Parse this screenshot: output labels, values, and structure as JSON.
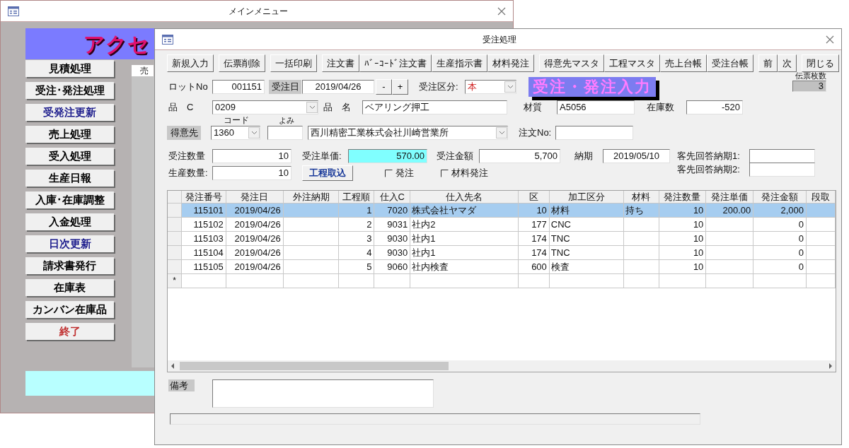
{
  "main_window": {
    "title": "メインメニュー",
    "banner": "アクセ",
    "tab": "売",
    "menu": [
      {
        "label": "見積処理",
        "color": "#000000"
      },
      {
        "label": "受注･発注処理",
        "color": "#000000"
      },
      {
        "label": "受発注更新",
        "color": "#1c1c8c"
      },
      {
        "label": "売上処理",
        "color": "#000000"
      },
      {
        "label": "受入処理",
        "color": "#000000"
      },
      {
        "label": "生産日報",
        "color": "#000000"
      },
      {
        "label": "入庫･在庫調整",
        "color": "#000000"
      },
      {
        "label": "入金処理",
        "color": "#000000"
      },
      {
        "label": "日次更新",
        "color": "#1c1c8c"
      },
      {
        "label": "請求書発行",
        "color": "#000000"
      },
      {
        "label": "在庫表",
        "color": "#000000"
      },
      {
        "label": "カンバン在庫品",
        "color": "#000000"
      },
      {
        "label": "終了",
        "color": "#c03030"
      }
    ]
  },
  "order_window": {
    "title": "受注処理",
    "toolbar": [
      [
        "新規入力"
      ],
      [
        "伝票削除"
      ],
      [
        "一括印刷"
      ],
      [
        "注文書",
        "ﾊﾞｰｺｰﾄﾞ注文書",
        "生産指示書",
        "材料発注"
      ],
      [
        "得意先マスタ",
        "工程マスタ",
        "売上台帳",
        "受注台帳"
      ],
      [
        "前",
        "次"
      ],
      [
        "閉じる"
      ]
    ],
    "form": {
      "lot_no": {
        "label": "ロットNo",
        "value": "001151"
      },
      "order_date": {
        "label": "受注日",
        "value": "2019/04/26"
      },
      "date_buttons": [
        "-",
        "+"
      ],
      "order_type": {
        "label": "受注区分:",
        "value": "本"
      },
      "form_title": "受注・発注入力",
      "slip_count": {
        "label": "伝票枚数",
        "value": "3"
      },
      "item_code": {
        "label": "品　C",
        "value": "0209"
      },
      "item_name": {
        "label": "品　名",
        "value": "ベアリング押工"
      },
      "material": {
        "label": "材質",
        "value": "A5056"
      },
      "stock": {
        "label": "在庫数",
        "value": "-520"
      },
      "customer": {
        "label": "得意先",
        "code_caption": "コード",
        "code": "1360",
        "reading_caption": "よみ",
        "name": "西川精密工業株式会社川崎営業所"
      },
      "po_no": {
        "label": "注文No:"
      },
      "order_qty": {
        "label": "受注数量",
        "value": "10"
      },
      "unit_price": {
        "label": "受注単価:",
        "value": "570.00"
      },
      "amount": {
        "label": "受注金額",
        "value": "5,700"
      },
      "due_date": {
        "label": "納期",
        "value": "2019/05/10"
      },
      "reply_due_1": {
        "label": "客先回答納期1:"
      },
      "production_qty": {
        "label": "生産数量:",
        "value": "10"
      },
      "import_button": "工程取込",
      "checkboxes": [
        {
          "label": "発注",
          "checked": false
        },
        {
          "label": "材料発注",
          "checked": false
        }
      ],
      "reply_due_2": {
        "label": "客先回答納期2:"
      }
    },
    "grid": {
      "columns": [
        {
          "label": "発注番号",
          "kind": "number"
        },
        {
          "label": "発注日",
          "kind": "number"
        },
        {
          "label": "外注納期",
          "kind": "number"
        },
        {
          "label": "工程順",
          "kind": "number"
        },
        {
          "label": "仕入C",
          "kind": "number"
        },
        {
          "label": "仕入先名",
          "kind": "text"
        },
        {
          "label": "区",
          "kind": "number"
        },
        {
          "label": "加工区分",
          "kind": "text"
        },
        {
          "label": "材料",
          "kind": "text"
        },
        {
          "label": "発注数量",
          "kind": "number"
        },
        {
          "label": "発注単価",
          "kind": "number"
        },
        {
          "label": "発注金額",
          "kind": "number"
        },
        {
          "label": "段取",
          "kind": "number"
        }
      ],
      "rows": [
        {
          "selected": true,
          "cells": [
            "115101",
            "2019/04/26",
            null,
            "1",
            "7020",
            "株式会社ヤマダ",
            "10",
            "材料",
            "持ち",
            "10",
            "200.00",
            "2,000",
            null
          ]
        },
        {
          "selected": false,
          "cells": [
            "115102",
            "2019/04/26",
            null,
            "2",
            "9031",
            "社内2",
            "177",
            "CNC",
            null,
            "10",
            null,
            "0",
            null
          ]
        },
        {
          "selected": false,
          "cells": [
            "115103",
            "2019/04/26",
            null,
            "3",
            "9030",
            "社内1",
            "174",
            "TNC",
            null,
            "10",
            null,
            "0",
            null
          ]
        },
        {
          "selected": false,
          "cells": [
            "115104",
            "2019/04/26",
            null,
            "4",
            "9030",
            "社内1",
            "174",
            "TNC",
            null,
            "10",
            null,
            "0",
            null
          ]
        },
        {
          "selected": false,
          "cells": [
            "115105",
            "2019/04/26",
            null,
            "5",
            "9060",
            "社内検査",
            "600",
            "検査",
            null,
            "10",
            null,
            "0",
            null
          ]
        }
      ],
      "new_row_marker": "*"
    },
    "remarks": {
      "label": "備考"
    }
  }
}
